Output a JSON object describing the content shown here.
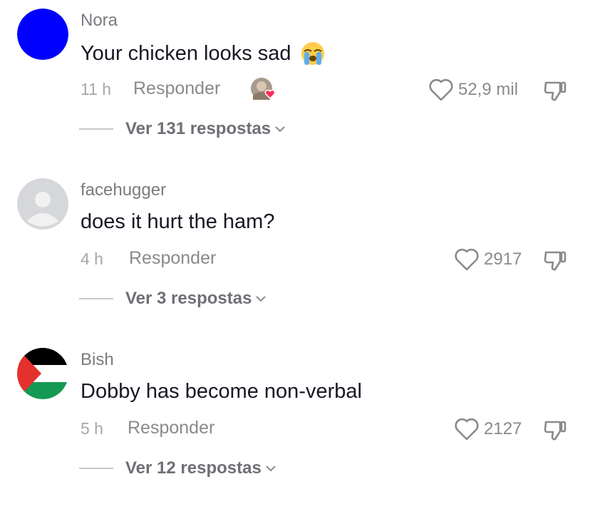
{
  "comments": [
    {
      "username": "Nora",
      "text": "Your chicken looks sad",
      "emoji": "loudly-crying-face-emoji",
      "avatar": "blue-circle-avatar",
      "time": "11 h",
      "reply_label": "Responder",
      "liked_by_creator": true,
      "likes": "52,9 mil",
      "view_replies": "Ver 131 respostas"
    },
    {
      "username": "facehugger",
      "text": "does it hurt the ham?",
      "avatar": "default-gray-avatar",
      "time": "4 h",
      "reply_label": "Responder",
      "liked_by_creator": false,
      "likes": "2917",
      "view_replies": "Ver 3 respostas"
    },
    {
      "username": "Bish",
      "text": "Dobby has become non-verbal",
      "avatar": "palestine-flag-avatar",
      "time": "5 h",
      "reply_label": "Responder",
      "liked_by_creator": false,
      "likes": "2127",
      "view_replies": "Ver 12 respostas"
    }
  ],
  "icons": {
    "like": "heart-outline-icon",
    "dislike": "thumbs-down-icon",
    "expand": "chevron-down-icon"
  },
  "colors": {
    "username": "#7b7b80",
    "meta": "#a7a7ab",
    "text": "#161823",
    "avatar_blue": "#0000ff",
    "heart_red": "#fe2c55"
  }
}
